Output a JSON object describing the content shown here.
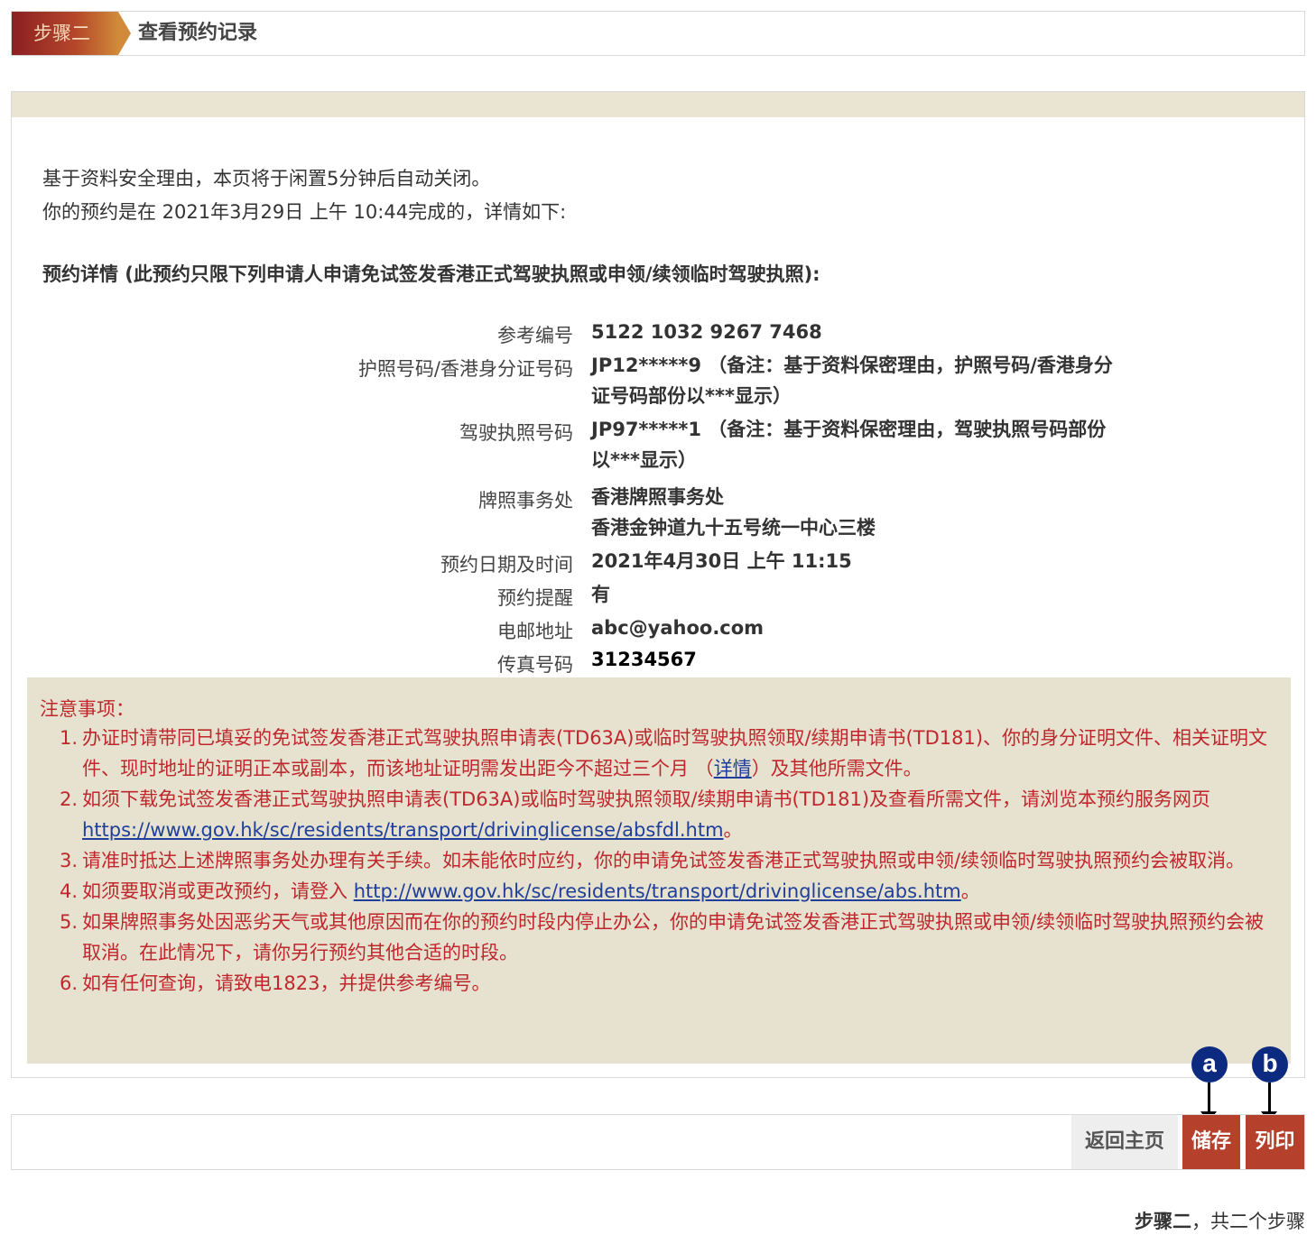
{
  "step_header": {
    "badge": "步骤二",
    "title": "查看预约记录"
  },
  "intro": {
    "line1": "基于资料安全理由，本页将于闲置5分钟后自动关闭。",
    "line2": "你的预约是在 2021年3月29日  上午 10:44完成的，详情如下:"
  },
  "details": {
    "heading": "预约详情 (此预约只限下列申请人申请免试签发香港正式驾驶执照或申领/续领临时驾驶执照):",
    "rows": [
      {
        "label": "参考编号",
        "value": "5122 1032 9267 7468"
      },
      {
        "label": "护照号码/香港身分证号码",
        "value": "JP12*****9 （备注：基于资料保密理由，护照号码/香港身分证号码部份以***显示）"
      },
      {
        "label": "驾驶执照号码",
        "value": "JP97*****1 （备注：基于资料保密理由，驾驶执照号码部份以***显示）"
      },
      {
        "label": "牌照事务处",
        "value": "香港牌照事务处",
        "value2": "香港金钟道九十五号统一中心三楼"
      },
      {
        "label": "预约日期及时间",
        "value": "2021年4月30日 上午 11:15"
      },
      {
        "label": "预约提醒",
        "value": "有"
      },
      {
        "label": "电邮地址",
        "value": "abc@yahoo.com"
      },
      {
        "label": "传真号码",
        "value": "31234567"
      }
    ]
  },
  "notes": {
    "title": "注意事项：",
    "items": [
      {
        "num": "1.",
        "text": "办证时请带同已填妥的免试签发香港正式驾驶执照申请表(TD63A)或临时驾驶执照领取/续期申请书(TD181)、你的身分证明文件、相关证明文件、现时地址的证明正本或副本，而该地址证明需发出距今不超过三个月 （",
        "link": "详情",
        "text_after": "）及其他所需文件。"
      },
      {
        "num": "2.",
        "text": "如须下载免试签发香港正式驾驶执照申请表(TD63A)或临时驾驶执照领取/续期申请书(TD181)及查看所需文件，请浏览本预约服务网页 ",
        "link": "https://www.gov.hk/sc/residents/transport/drivinglicense/absfdl.htm",
        "text_after": "。"
      },
      {
        "num": "3.",
        "text": "请准时抵达上述牌照事务处办理有关手续。如未能依时应约，你的申请免试签发香港正式驾驶执照或申领/续领临时驾驶执照预约会被取消。",
        "link": "",
        "text_after": ""
      },
      {
        "num": "4.",
        "text": "如须要取消或更改预约，请登入 ",
        "link": "http://www.gov.hk/sc/residents/transport/drivinglicense/abs.htm",
        "text_after": "。"
      },
      {
        "num": "5.",
        "text": "如果牌照事务处因恶劣天气或其他原因而在你的预约时段内停止办公，你的申请免试签发香港正式驾驶执照或申领/续领临时驾驶执照预约会被取消。在此情况下，请你另行预约其他合适的时段。",
        "link": "",
        "text_after": ""
      },
      {
        "num": "6.",
        "text": "如有任何查询，请致电1823，并提供参考编号。",
        "link": "",
        "text_after": ""
      }
    ]
  },
  "markers": {
    "a": "a",
    "b": "b"
  },
  "actions": {
    "home": "返回主页",
    "save": "储存",
    "print": "列印"
  },
  "footer": {
    "step_bold": "步骤二",
    "step_rest": "，共二个步骤"
  },
  "colors": {
    "accent": "#b5402b",
    "notes_bg": "#e6e2cf",
    "notes_text": "#c0272d",
    "marker": "#0b2a80"
  }
}
